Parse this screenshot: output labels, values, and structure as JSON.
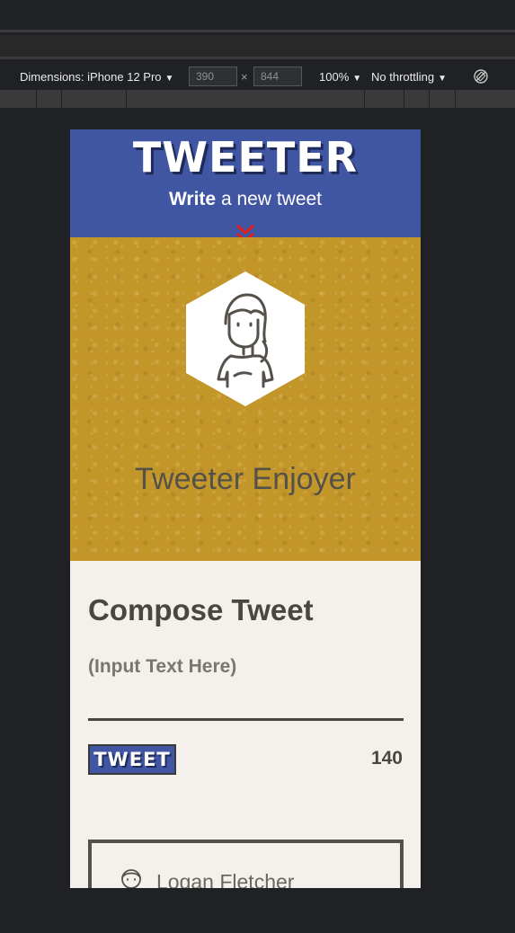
{
  "devtools": {
    "device_label": "Dimensions: iPhone 12 Pro",
    "width_value": "390",
    "height_value": "844",
    "times": "×",
    "zoom": "100%",
    "throttling": "No throttling",
    "dropdown_arrow": "▼"
  },
  "header": {
    "logo": "TWEETER",
    "subtitle_bold": "Write",
    "subtitle_rest": " a new tweet"
  },
  "profile": {
    "name": "Tweeter Enjoyer"
  },
  "compose": {
    "title": "Compose Tweet",
    "placeholder": "(Input Text Here)",
    "button_label": "TWEET",
    "counter": "140"
  },
  "tweets": [
    {
      "user": "Logan Fletcher"
    }
  ],
  "colors": {
    "header_bg": "#4156a3",
    "profile_bg": "#c3962a",
    "page_bg": "#f4f1ec",
    "chevron": "#e01b1b",
    "text_dark": "#4a4640"
  }
}
